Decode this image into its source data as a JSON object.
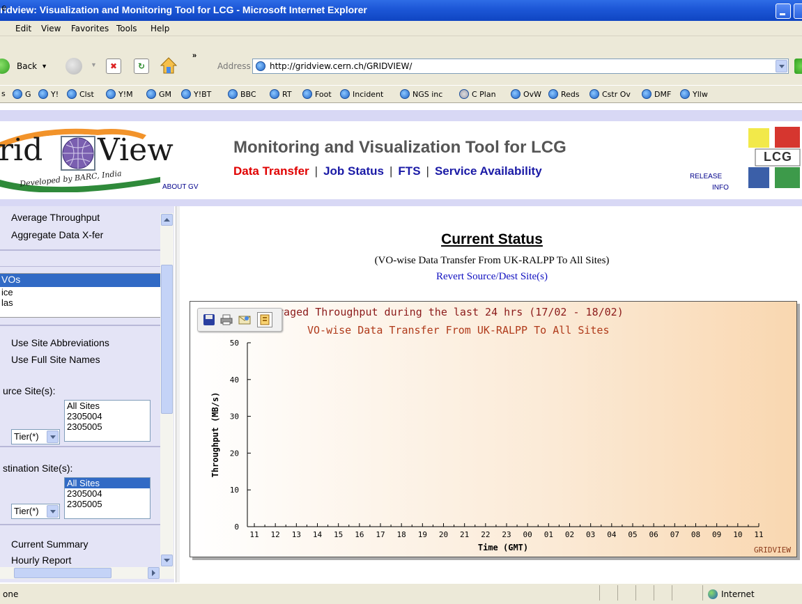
{
  "window": {
    "title": "ridview: Visualization and Monitoring Tool for LCG - Microsoft Internet Explorer"
  },
  "menu": [
    "e",
    "Edit",
    "View",
    "Favorites",
    "Tools",
    "Help"
  ],
  "toolbar": {
    "back_label": "Back",
    "address_label": "Address",
    "address_value": "http://gridview.cern.ch/GRIDVIEW/"
  },
  "links": [
    "s",
    "G",
    "Y!",
    "Clst",
    "Y!M",
    "GM",
    "Y!BT",
    "BBC",
    "RT",
    "Foot",
    "Incident",
    "NGS inc",
    "C Plan",
    "OvW",
    "Reds",
    "Cstr Ov",
    "DMF",
    "Yllw"
  ],
  "header": {
    "logo_text_left": "rid",
    "logo_text_right": "View",
    "logo_tagline": "Developed by BARC, India",
    "title": "Monitoring and Visualization Tool for LCG",
    "nav": [
      "Data Transfer",
      "Job Status",
      "FTS",
      "Service Availability"
    ],
    "about": "ABOUT GV",
    "release_line1": "RELEASE",
    "release_line2": "INFO",
    "lcg_logo": "LCG"
  },
  "left_panel": {
    "item_avg_throughput": "Average Throughput",
    "item_aggregate": "Aggregate Data X-fer",
    "list_vos": "VOs",
    "list_ice": "ice",
    "list_las": "las",
    "radio_abbrev": "Use Site Abbreviations",
    "radio_full": "Use Full Site Names",
    "source_label": "urce Site(s):",
    "dest_label": "stination Site(s):",
    "tier_select": "Tier(*)",
    "site_options": [
      "All Sites",
      "2305004",
      "2305005"
    ],
    "current_summary": "Current Summary",
    "hourly_report": "Hourly Report"
  },
  "main": {
    "title": "Current Status",
    "subtitle": "(VO-wise Data Transfer From UK-RALPP To All Sites)",
    "revert_link": "Revert Source/Dest Site(s)"
  },
  "status": {
    "left": "one",
    "zone": "Internet"
  },
  "chart_data": {
    "type": "line",
    "title": "eraged Throughput during the last 24 hrs (17/02 - 18/02)",
    "subtitle": "VO-wise Data Transfer From UK-RALPP To All Sites",
    "xlabel": "Time (GMT)",
    "ylabel": "Throughput (MB/s)",
    "ylim": [
      0,
      50
    ],
    "yticks": [
      0,
      10,
      20,
      30,
      40,
      50
    ],
    "x": [
      "11",
      "12",
      "13",
      "14",
      "15",
      "16",
      "17",
      "18",
      "19",
      "20",
      "21",
      "22",
      "23",
      "00",
      "01",
      "02",
      "03",
      "04",
      "05",
      "06",
      "07",
      "08",
      "09",
      "10",
      "11"
    ],
    "series": [],
    "watermark": "GRIDVIEW",
    "grid": false
  },
  "colors": {
    "title_bar": "#1c56d6",
    "nav_active": "#e00000",
    "nav_link": "#1a1aa6",
    "chart_title": "#8b1a1a",
    "chart_subtitle": "#b03a1a",
    "panel_bg": "#e4e4f6",
    "selection": "#316ac5"
  },
  "icons": [
    "back-arrow-icon",
    "forward-arrow-icon",
    "stop-icon",
    "refresh-icon",
    "home-icon",
    "ie-page-icon",
    "go-arrow-icon",
    "save-icon",
    "print-icon",
    "email-icon",
    "export-icon",
    "internet-globe-icon"
  ]
}
